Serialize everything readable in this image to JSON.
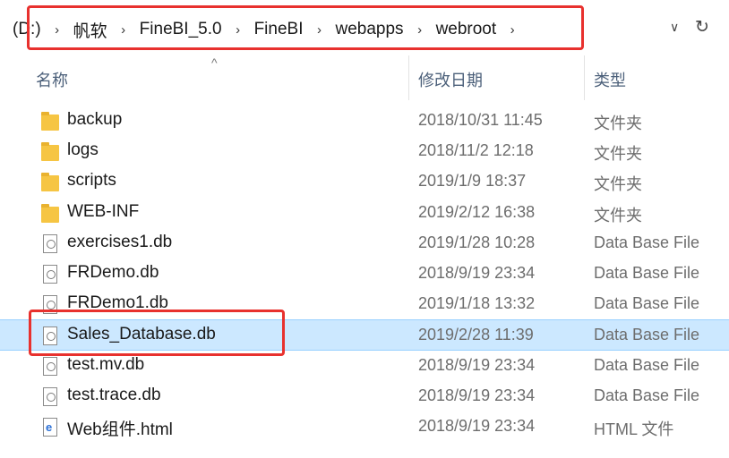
{
  "address": {
    "drive": "(D:)",
    "segments": [
      "帆软",
      "FineBI_5.0",
      "FineBI",
      "webapps",
      "webroot"
    ],
    "separator": "›",
    "dropdown_glyph": "∨",
    "refresh_glyph": "↻"
  },
  "columns": {
    "name": "名称",
    "modified": "修改日期",
    "type": "类型",
    "sort_glyph": "^"
  },
  "files": [
    {
      "name": "backup",
      "modified": "2018/10/31 11:45",
      "type": "文件夹",
      "icon": "folder-icon"
    },
    {
      "name": "logs",
      "modified": "2018/11/2 12:18",
      "type": "文件夹",
      "icon": "folder-icon"
    },
    {
      "name": "scripts",
      "modified": "2019/1/9 18:37",
      "type": "文件夹",
      "icon": "folder-icon"
    },
    {
      "name": "WEB-INF",
      "modified": "2019/2/12 16:38",
      "type": "文件夹",
      "icon": "folder-icon"
    },
    {
      "name": "exercises1.db",
      "modified": "2019/1/28 10:28",
      "type": "Data Base File",
      "icon": "db-file-icon"
    },
    {
      "name": "FRDemo.db",
      "modified": "2018/9/19 23:34",
      "type": "Data Base File",
      "icon": "db-file-icon"
    },
    {
      "name": "FRDemo1.db",
      "modified": "2019/1/18 13:32",
      "type": "Data Base File",
      "icon": "db-file-icon"
    },
    {
      "name": "Sales_Database.db",
      "modified": "2019/2/28 11:39",
      "type": "Data Base File",
      "icon": "db-file-icon"
    },
    {
      "name": "test.mv.db",
      "modified": "2018/9/19 23:34",
      "type": "Data Base File",
      "icon": "db-file-icon"
    },
    {
      "name": "test.trace.db",
      "modified": "2018/9/19 23:34",
      "type": "Data Base File",
      "icon": "db-file-icon"
    },
    {
      "name": "Web组件.html",
      "modified": "2018/9/19 23:34",
      "type": "HTML 文件",
      "icon": "html-file-icon"
    }
  ],
  "html_icon_letter": "e",
  "selected_index": 7,
  "colors": {
    "highlight_box": "#e8312e",
    "selection": "#cce8ff",
    "folder": "#f6c543",
    "header_text": "#4c607a"
  }
}
